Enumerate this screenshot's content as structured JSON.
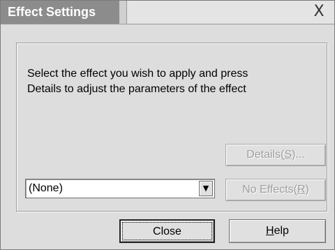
{
  "window": {
    "title": "Effect Settings",
    "close_glyph": "X"
  },
  "description": {
    "line1": "Select the effect you wish to apply and press",
    "line2": "Details to adjust the parameters of the effect"
  },
  "effect_select": {
    "value": "(None)",
    "arrow_icon": "chevron-down-icon"
  },
  "buttons": {
    "details": {
      "prefix": "Details(",
      "mnemonic": "S",
      "suffix": ")...",
      "enabled": false
    },
    "no_effects": {
      "prefix": "No Effects(",
      "mnemonic": "R",
      "suffix": ")",
      "enabled": false
    },
    "close": {
      "label": "Close"
    },
    "help": {
      "mnemonic": "H",
      "rest": "elp"
    }
  }
}
